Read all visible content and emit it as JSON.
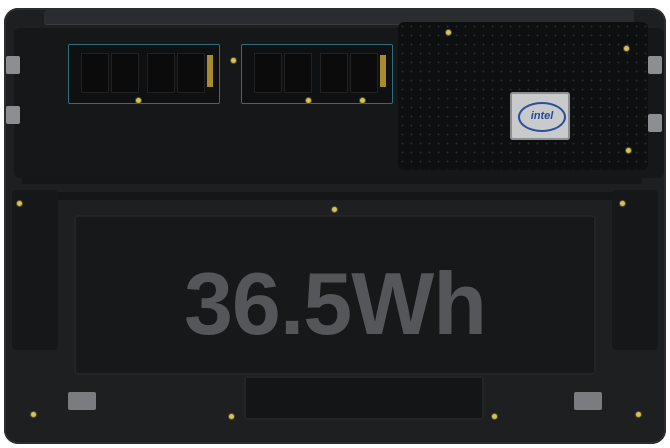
{
  "photo": {
    "capacity_text": "36.5Wh",
    "cpu_logo_text": "intel"
  },
  "colors": {
    "chassis": "#1e1f21",
    "ssd_outline": "#2f6f7d",
    "capacity_text": "#545659",
    "screw": "#d6c25a"
  }
}
